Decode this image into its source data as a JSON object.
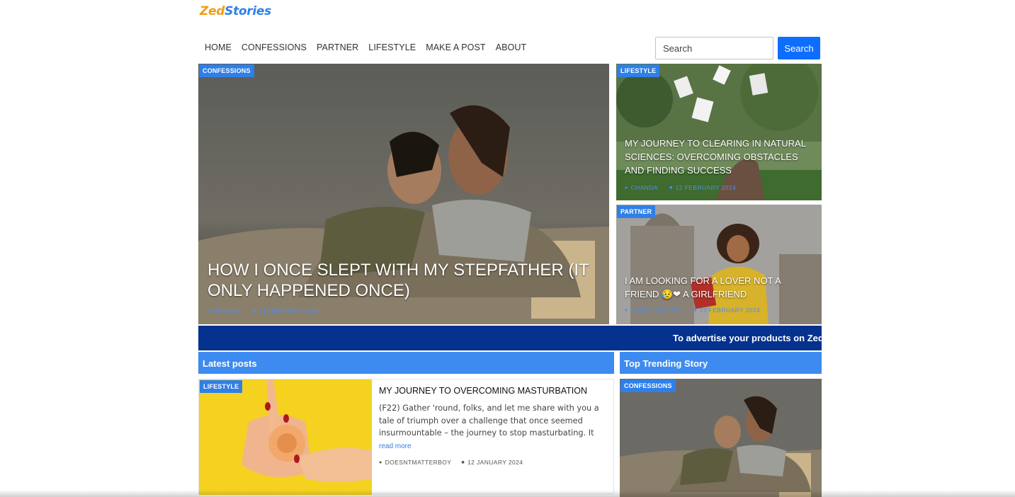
{
  "brand": {
    "part1": "Zed",
    "part2": "Stories"
  },
  "nav": {
    "items": [
      "HOME",
      "CONFESSIONS",
      "PARTNER",
      "LIFESTYLE",
      "MAKE A POST",
      "ABOUT"
    ]
  },
  "search": {
    "placeholder": "Search",
    "button_label": "Search"
  },
  "hero": {
    "category": "CONFESSIONS",
    "title": "HOW I ONCE SLEPT WITH MY STEPFATHER (IT ONLY HAPPENED ONCE)",
    "author": "IMAGINE",
    "date": "23 FEBRUARY 2024"
  },
  "side_posts": [
    {
      "category": "LIFESTYLE",
      "title": "MY JOURNEY TO CLEARING IN NATURAL SCIENCES: OVERCOMING OBSTACLES AND FINDING SUCCESS",
      "author": "CHANDA",
      "date": "12 FEBRUARY 2024"
    },
    {
      "category": "PARTNER",
      "title": "I AM LOOKING FOR A LOVER NOT A FRIEND 😥❤ A GIRLFRIEND",
      "author": "BANDA MADULO",
      "date": "13 FEBRUARY 2024"
    }
  ],
  "ad_banner": {
    "text": "To advertise your products on ZedS"
  },
  "latest": {
    "heading": "Latest posts",
    "post": {
      "category": "LIFESTYLE",
      "title": "MY JOURNEY TO OVERCOMING MASTURBATION",
      "excerpt": "(F22) Gather 'round, folks, and let me share with you a tale of triumph over a challenge that once seemed insurmountable – the journey to stop masturbating. It",
      "read_more": "read more",
      "author": "DOESNTMATTERBOY",
      "date": "12 JANUARY 2024"
    }
  },
  "trending": {
    "heading": "Top Trending Story",
    "category": "CONFESSIONS"
  },
  "icons": {
    "author": "user-icon",
    "date": "calendar-icon"
  },
  "colors": {
    "accent": "#2f7fe8",
    "brand_orange": "#f39c12",
    "ad_bar": "#05328e",
    "search_button": "#0d6efd"
  }
}
